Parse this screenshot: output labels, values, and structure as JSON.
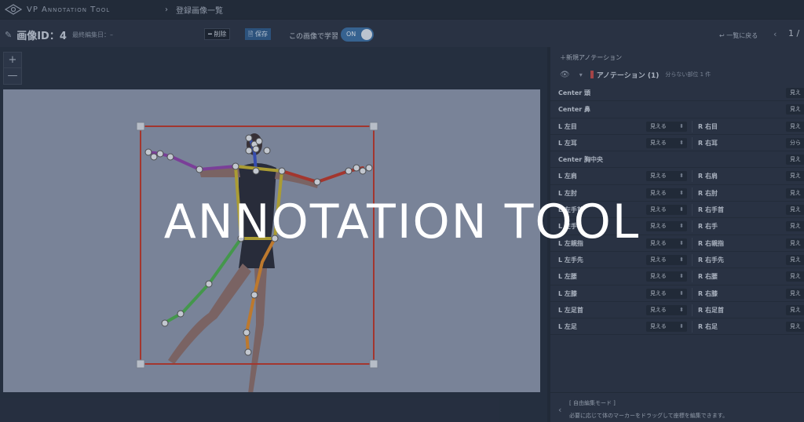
{
  "header": {
    "app_name": "VP Annotation Tool",
    "breadcrumb": "登録画像一覧"
  },
  "toolbar": {
    "image_id": "画像ID：4",
    "last_edited": "最終編集日：–",
    "delete_label": "削除",
    "save_label": "保存",
    "learn_label": "この画像で学習",
    "toggle_label": "ON",
    "back_label": "一覧に戻る",
    "pager": "1 /"
  },
  "canvas": {
    "zoom_in": "+",
    "zoom_out": "—"
  },
  "panel": {
    "new_annotation": "＋新規アノテーション",
    "annotation_title": "アノテーション (1)",
    "annotation_count": "分らない部位 1 件",
    "rows": [
      {
        "left": "Center 頭",
        "left_sel": "",
        "right": "",
        "right_sel": "見え"
      },
      {
        "left": "Center 鼻",
        "left_sel": "",
        "right": "",
        "right_sel": "見え"
      },
      {
        "left": "L 左目",
        "left_sel": "見える",
        "right": "R 右目",
        "right_sel": "見え"
      },
      {
        "left": "L 左耳",
        "left_sel": "見える",
        "right": "R 右耳",
        "right_sel": "分ら"
      },
      {
        "left": "Center 胸中央",
        "left_sel": "",
        "right": "",
        "right_sel": "見え"
      },
      {
        "left": "L 左肩",
        "left_sel": "見える",
        "right": "R 右肩",
        "right_sel": "見え"
      },
      {
        "left": "L 左肘",
        "left_sel": "見える",
        "right": "R 右肘",
        "right_sel": "見え"
      },
      {
        "left": "L 左手首",
        "left_sel": "見える",
        "right": "R 右手首",
        "right_sel": "見え"
      },
      {
        "left": "L 左手",
        "left_sel": "見える",
        "right": "R 右手",
        "right_sel": "見え"
      },
      {
        "left": "L 左親指",
        "left_sel": "見える",
        "right": "R 右親指",
        "right_sel": "見え"
      },
      {
        "left": "L 左手先",
        "left_sel": "見える",
        "right": "R 右手先",
        "right_sel": "見え"
      },
      {
        "left": "L 左腰",
        "left_sel": "見える",
        "right": "R 右腰",
        "right_sel": "見え"
      },
      {
        "left": "L 左膝",
        "left_sel": "見える",
        "right": "R 右膝",
        "right_sel": "見え"
      },
      {
        "left": "L 左足首",
        "left_sel": "見える",
        "right": "R 右足首",
        "right_sel": "見え"
      },
      {
        "left": "L 左足",
        "left_sel": "見える",
        "right": "R 右足",
        "right_sel": "見え"
      }
    ],
    "mode_label": "[ 自由編集モード ]",
    "hint": "必要に応じて体のマーカーをドラッグして座標を編集できます。"
  },
  "overlay": {
    "title": "ANNOTATION TOOL"
  },
  "colors": {
    "accent": "#3b6ea3",
    "bbox": "#c0392b",
    "bg": "#2b3445"
  }
}
